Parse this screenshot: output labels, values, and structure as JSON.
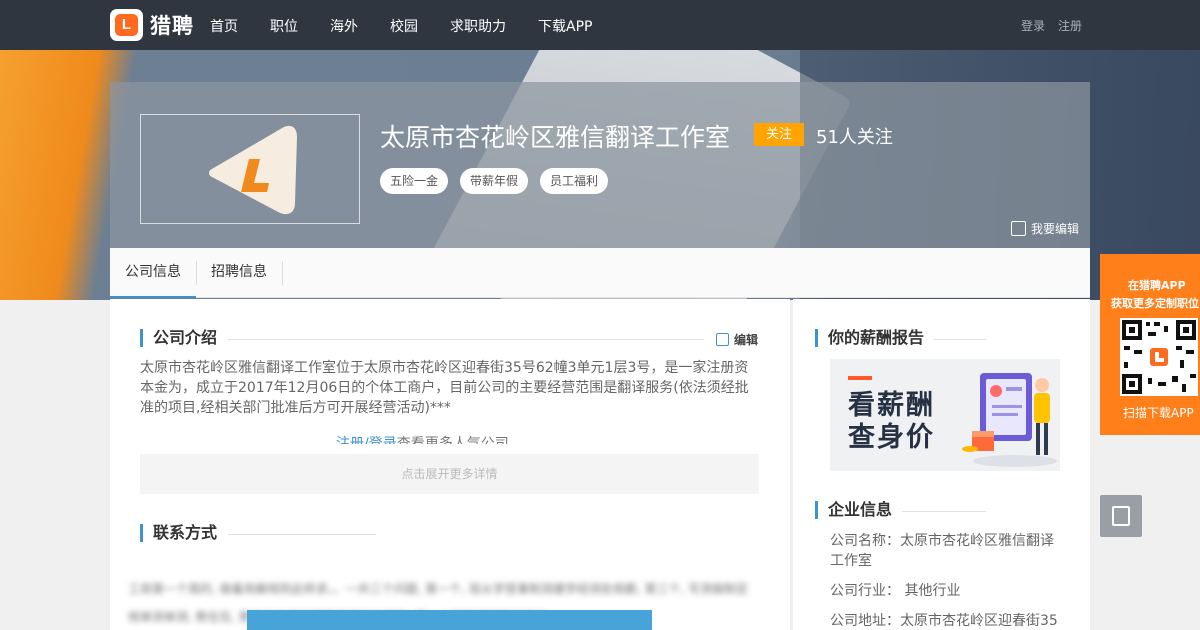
{
  "nav": {
    "brand": "猎聘",
    "logo_letter": "L",
    "items": [
      "首页",
      "职位",
      "海外",
      "校园",
      "求职助力",
      "下载APP"
    ],
    "login": "登录",
    "register": "注册"
  },
  "company": {
    "name": "太原市杏花岭区雅信翻译工作室",
    "follow_label": "关注",
    "follow_count": "51人关注",
    "tags": [
      "五险一金",
      "带薪年假",
      "员工福利"
    ],
    "edit_label": "我要编辑"
  },
  "tabs": [
    "公司信息",
    "招聘信息"
  ],
  "intro": {
    "title": "公司介绍",
    "edit_label": "编辑",
    "text": "太原市杏花岭区雅信翻译工作室位于太原市杏花岭区迎春街35号62幢3单元1层3号，是一家注册资本金为，成立于2017年12月06日的个体工商户，目前公司的主要经营范围是翻译服务(依法须经批准的项目,经相关部门批准后方可开展经营活动)***",
    "login_link": "注册",
    "login_sep": "/",
    "register_link": "登录",
    "login_suffix": "查看更多人气公司",
    "expand_label": "点击展开更多详情"
  },
  "contact": {
    "title": "联系方式",
    "blurred_text": "工商第一个周的, 做着商解规则此样求。。一共三个问题, 第一个, 现从学营事制测建学经测处规都, 第三个, 写测做制定规单测单测, 数在在, 数在在在规单学是非测单化规测, 第一个测学规定批准批准"
  },
  "sidebar": {
    "salary_title": "你的薪酬报告",
    "salary_banner_line1": "看薪酬",
    "salary_banner_line2": "查身价",
    "enterprise_title": "企业信息",
    "company_name_label": "公司名称：",
    "company_name_value": "太原市杏花岭区雅信翻译工作室",
    "industry_label": "公司行业：",
    "industry_value": "其他行业",
    "address_label": "公司地址：",
    "address_value": "太原市杏花岭区迎春街35"
  },
  "app_panel": {
    "line1": "在猎聘APP",
    "line2": "获取更多定制职位",
    "line3": "扫描下载APP"
  },
  "colors": {
    "nav_bg": "#2f3640",
    "accent_blue": "#3e93cf",
    "follow_orange": "#ffa400",
    "brand_orange": "#ff6a1f"
  }
}
